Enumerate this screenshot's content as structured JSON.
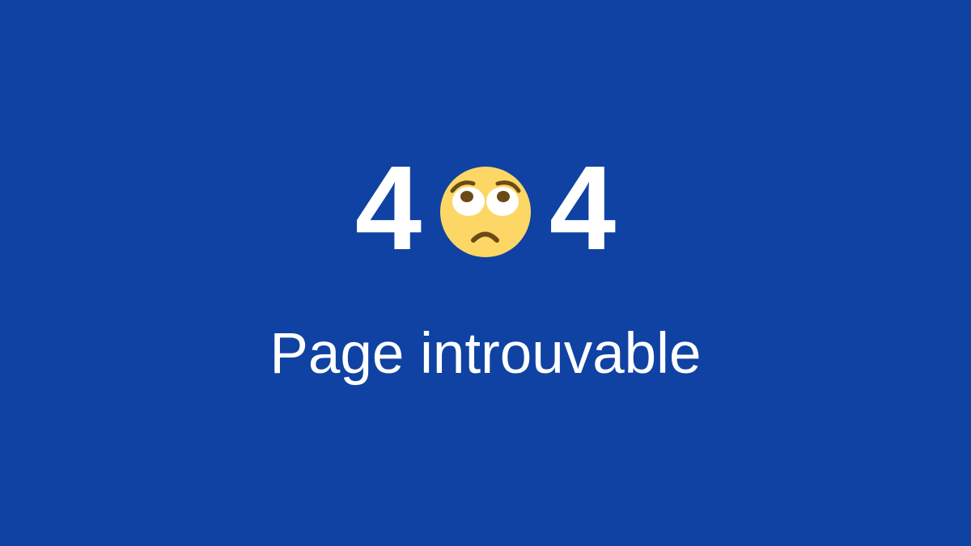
{
  "error": {
    "code_first_digit": "4",
    "code_last_digit": "4",
    "face_icon": "face-with-rolling-eyes-icon",
    "message": "Page introuvable"
  },
  "colors": {
    "background": "#0f42a2",
    "text": "#ffffff",
    "emoji_face": "#fdd765",
    "emoji_features": "#6b4a16"
  }
}
